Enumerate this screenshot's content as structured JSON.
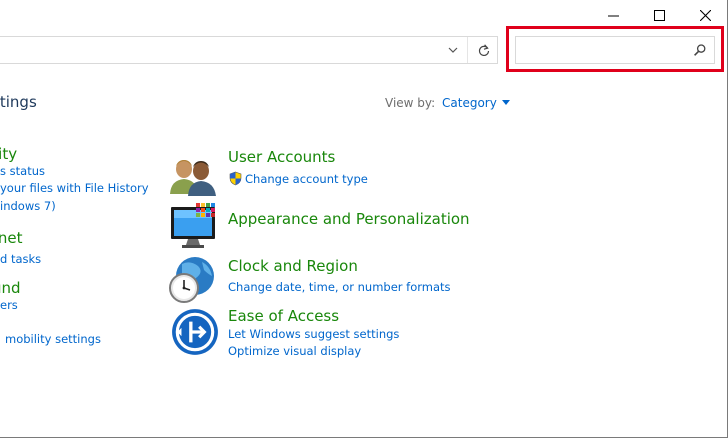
{
  "window": {
    "minimize_glyph": "—",
    "maximize_glyph": "☐",
    "close_glyph": "✕"
  },
  "address_bar": {
    "path": "",
    "dropdown_icon": "chevron-down-icon",
    "refresh_icon": "refresh-icon"
  },
  "search": {
    "value": "",
    "placeholder": "",
    "icon": "search-icon",
    "highlight_color": "#e0001b"
  },
  "header": {
    "title": "ttings",
    "view_by_label": "View by:",
    "view_by_value": "Category"
  },
  "left_column": {
    "system_heading": "rity",
    "system_links": [
      "s status",
      "your files with File History",
      "indows 7)"
    ],
    "network_heading": "rnet",
    "network_links": [
      "d tasks"
    ],
    "hardware_heading": "und",
    "hardware_links": [
      "ers"
    ],
    "mobility_link": "mobility settings"
  },
  "categories": [
    {
      "heading": "User Accounts",
      "icon": "user-accounts-icon",
      "links": [
        "Change account type"
      ]
    },
    {
      "heading": "Appearance and Personalization",
      "icon": "appearance-icon",
      "links": []
    },
    {
      "heading": "Clock and Region",
      "icon": "clock-region-icon",
      "links": [
        "Change date, time, or number formats"
      ]
    },
    {
      "heading": "Ease of Access",
      "icon": "ease-of-access-icon",
      "links": [
        "Let Windows suggest settings",
        "Optimize visual display"
      ]
    }
  ],
  "colors": {
    "heading_green": "#19870b",
    "link_blue": "#0066cc",
    "title_navy": "#1e395b"
  }
}
